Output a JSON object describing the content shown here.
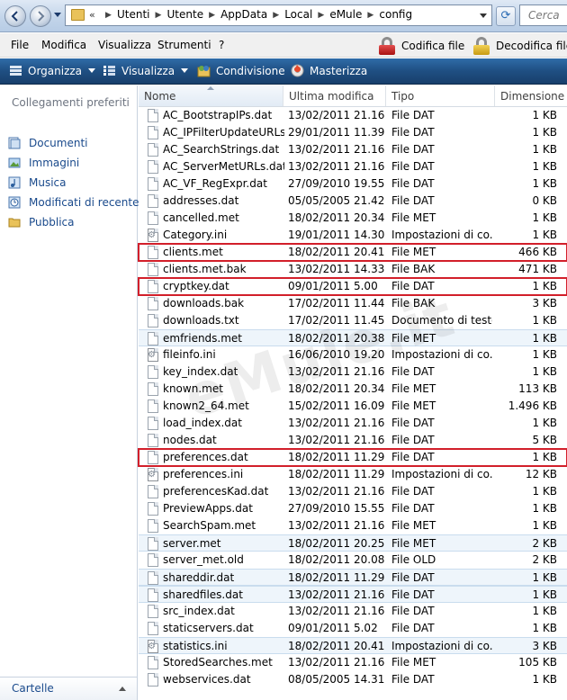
{
  "address": {
    "crumbs": [
      "Utenti",
      "Utente",
      "AppData",
      "Local",
      "eMule",
      "config"
    ],
    "overflow_marker": "«",
    "search_placeholder": "Cerca"
  },
  "menubar": {
    "items": [
      "File",
      "Modifica",
      "Visualizza",
      "Strumenti",
      "?"
    ],
    "encrypt_label": "Codifica file",
    "decrypt_label": "Decodifica file"
  },
  "commandbar": {
    "organize_label": "Organizza",
    "view_label": "Visualizza",
    "share_label": "Condivisione",
    "burn_label": "Masterizza"
  },
  "sidebar": {
    "heading": "Collegamenti preferiti",
    "items": [
      "Documenti",
      "Immagini",
      "Musica",
      "Modificati di recente",
      "Pubblica"
    ],
    "footer_label": "Cartelle"
  },
  "columns": {
    "name": "Nome",
    "modified": "Ultima modifica",
    "type": "Tipo",
    "size": "Dimensione"
  },
  "watermark": "eMule.it",
  "files": [
    {
      "name": "AC_BootstrapIPs.dat",
      "date": "13/02/2011 21.16",
      "type": "File DAT",
      "size": "1 KB",
      "kind": "file",
      "style": ""
    },
    {
      "name": "AC_IPFilterUpdateURLs...",
      "date": "29/01/2011 11.39",
      "type": "File DAT",
      "size": "1 KB",
      "kind": "file",
      "style": ""
    },
    {
      "name": "AC_SearchStrings.dat",
      "date": "13/02/2011 21.16",
      "type": "File DAT",
      "size": "1 KB",
      "kind": "file",
      "style": ""
    },
    {
      "name": "AC_ServerMetURLs.dat",
      "date": "13/02/2011 21.16",
      "type": "File DAT",
      "size": "1 KB",
      "kind": "file",
      "style": ""
    },
    {
      "name": "AC_VF_RegExpr.dat",
      "date": "27/09/2010 19.55",
      "type": "File DAT",
      "size": "1 KB",
      "kind": "file",
      "style": ""
    },
    {
      "name": "addresses.dat",
      "date": "05/05/2005 21.42",
      "type": "File DAT",
      "size": "0 KB",
      "kind": "file",
      "style": ""
    },
    {
      "name": "cancelled.met",
      "date": "18/02/2011 20.34",
      "type": "File MET",
      "size": "1 KB",
      "kind": "file",
      "style": ""
    },
    {
      "name": "Category.ini",
      "date": "19/01/2011 14.30",
      "type": "Impostazioni di co...",
      "size": "1 KB",
      "kind": "ini",
      "style": ""
    },
    {
      "name": "clients.met",
      "date": "18/02/2011 20.41",
      "type": "File MET",
      "size": "466 KB",
      "kind": "file",
      "style": "hl"
    },
    {
      "name": "clients.met.bak",
      "date": "13/02/2011 14.33",
      "type": "File BAK",
      "size": "471 KB",
      "kind": "file",
      "style": ""
    },
    {
      "name": "cryptkey.dat",
      "date": "09/01/2011 5.00",
      "type": "File DAT",
      "size": "1 KB",
      "kind": "file",
      "style": "hl"
    },
    {
      "name": "downloads.bak",
      "date": "17/02/2011 11.44",
      "type": "File BAK",
      "size": "3 KB",
      "kind": "file",
      "style": ""
    },
    {
      "name": "downloads.txt",
      "date": "17/02/2011 11.45",
      "type": "Documento di testo",
      "size": "1 KB",
      "kind": "file",
      "style": ""
    },
    {
      "name": "emfriends.met",
      "date": "18/02/2011 20.38",
      "type": "File MET",
      "size": "1 KB",
      "kind": "file",
      "style": "alt"
    },
    {
      "name": "fileinfo.ini",
      "date": "16/06/2010 19.20",
      "type": "Impostazioni di co...",
      "size": "1 KB",
      "kind": "ini",
      "style": ""
    },
    {
      "name": "key_index.dat",
      "date": "13/02/2011 21.16",
      "type": "File DAT",
      "size": "1 KB",
      "kind": "file",
      "style": ""
    },
    {
      "name": "known.met",
      "date": "18/02/2011 20.34",
      "type": "File MET",
      "size": "113 KB",
      "kind": "file",
      "style": ""
    },
    {
      "name": "known2_64.met",
      "date": "15/02/2011 16.09",
      "type": "File MET",
      "size": "1.496 KB",
      "kind": "file",
      "style": ""
    },
    {
      "name": "load_index.dat",
      "date": "13/02/2011 21.16",
      "type": "File DAT",
      "size": "1 KB",
      "kind": "file",
      "style": ""
    },
    {
      "name": "nodes.dat",
      "date": "13/02/2011 21.16",
      "type": "File DAT",
      "size": "5 KB",
      "kind": "file",
      "style": ""
    },
    {
      "name": "preferences.dat",
      "date": "18/02/2011 11.29",
      "type": "File DAT",
      "size": "1 KB",
      "kind": "file",
      "style": "hl"
    },
    {
      "name": "preferences.ini",
      "date": "18/02/2011 11.29",
      "type": "Impostazioni di co...",
      "size": "12 KB",
      "kind": "ini",
      "style": ""
    },
    {
      "name": "preferencesKad.dat",
      "date": "13/02/2011 21.16",
      "type": "File DAT",
      "size": "1 KB",
      "kind": "file",
      "style": ""
    },
    {
      "name": "PreviewApps.dat",
      "date": "27/09/2010 15.55",
      "type": "File DAT",
      "size": "1 KB",
      "kind": "file",
      "style": ""
    },
    {
      "name": "SearchSpam.met",
      "date": "13/02/2011 21.16",
      "type": "File MET",
      "size": "1 KB",
      "kind": "file",
      "style": ""
    },
    {
      "name": "server.met",
      "date": "18/02/2011 20.25",
      "type": "File MET",
      "size": "2 KB",
      "kind": "file",
      "style": "alt"
    },
    {
      "name": "server_met.old",
      "date": "18/02/2011 20.08",
      "type": "File OLD",
      "size": "2 KB",
      "kind": "file",
      "style": ""
    },
    {
      "name": "shareddir.dat",
      "date": "18/02/2011 11.29",
      "type": "File DAT",
      "size": "1 KB",
      "kind": "file",
      "style": "alt"
    },
    {
      "name": "sharedfiles.dat",
      "date": "13/02/2011 21.16",
      "type": "File DAT",
      "size": "1 KB",
      "kind": "file",
      "style": "alt"
    },
    {
      "name": "src_index.dat",
      "date": "13/02/2011 21.16",
      "type": "File DAT",
      "size": "1 KB",
      "kind": "file",
      "style": ""
    },
    {
      "name": "staticservers.dat",
      "date": "09/01/2011 5.02",
      "type": "File DAT",
      "size": "1 KB",
      "kind": "file",
      "style": ""
    },
    {
      "name": "statistics.ini",
      "date": "18/02/2011 20.41",
      "type": "Impostazioni di co...",
      "size": "3 KB",
      "kind": "ini",
      "style": "alt"
    },
    {
      "name": "StoredSearches.met",
      "date": "13/02/2011 21.16",
      "type": "File MET",
      "size": "105 KB",
      "kind": "file",
      "style": ""
    },
    {
      "name": "webservices.dat",
      "date": "08/05/2005 14.31",
      "type": "File DAT",
      "size": "1 KB",
      "kind": "file",
      "style": ""
    }
  ]
}
